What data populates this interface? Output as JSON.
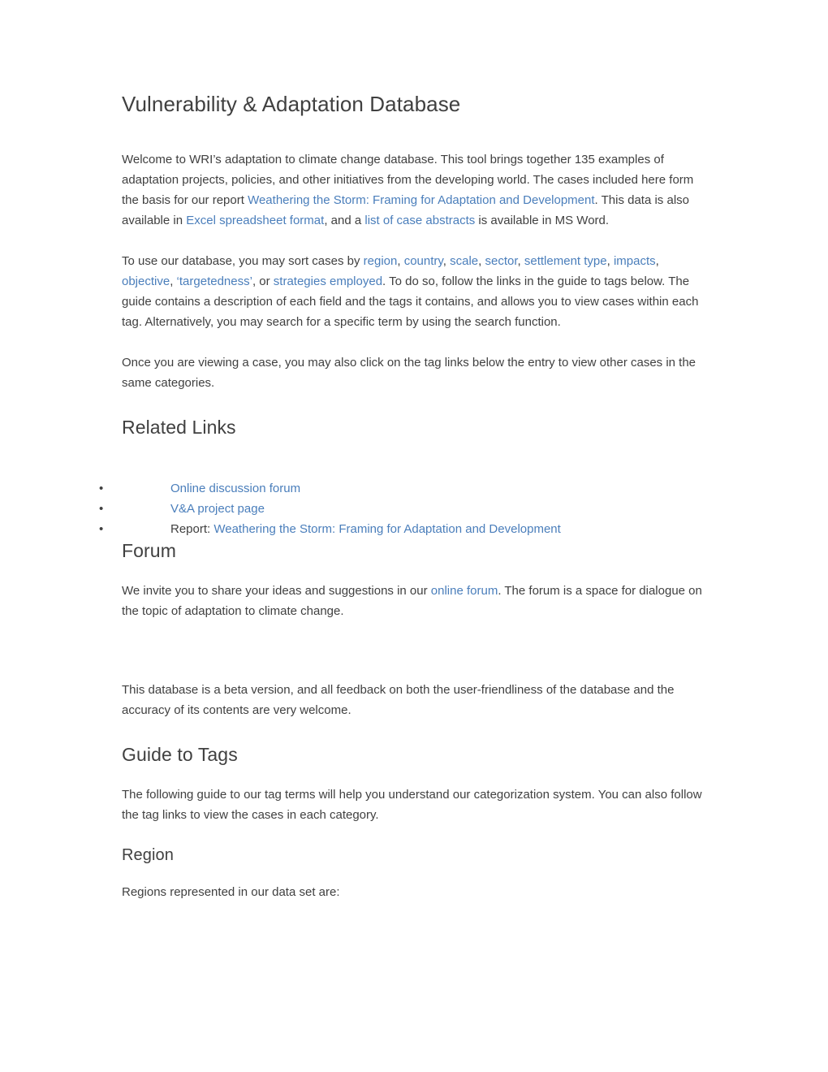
{
  "document": {
    "title": "Vulnerability & Adaptation Database",
    "intro": {
      "p1_part1": "Welcome to WRI’s adaptation to climate change database. This tool brings together 135 examples of adaptation projects, policies, and other initiatives from the developing world. The cases included here form the basis for our report ",
      "p1_link1": "Weathering the Storm: Framing for Adaptation and Development",
      "p1_part2": ". This data is also available in ",
      "p1_link2": "Excel spreadsheet format",
      "p1_part3": ", and a ",
      "p1_link3": "list of case abstracts",
      "p1_part4": " is available in MS Word."
    },
    "sorting": {
      "lead": "To use our database, you may sort cases by ",
      "link_region": "region",
      "sep1": ", ",
      "link_country": "country",
      "sep2": ", ",
      "link_scale": "scale",
      "sep3": ", ",
      "link_sector": "sector",
      "sep4": ", ",
      "link_settlement_type": "settlement type",
      "sep5": ", ",
      "link_impacts": "impacts",
      "sep6": ", ",
      "link_objective": "objective",
      "sep7": ", ",
      "link_targetedness": "‘targetedness’",
      "sep8": ", or ",
      "link_strategies": "strategies employed",
      "tail": ". To do so, follow the links in the guide to tags below. The guide contains a description of each field and the tags it contains, and allows you to view cases within each tag. Alternatively, you may search for a specific term by using the search function."
    },
    "viewing_paragraph": "Once you are viewing a case, you may also click on the tag links below the entry to view other cases in the same categories.",
    "related_links": {
      "heading": "Related Links",
      "items": [
        {
          "bullet": "•",
          "prefix": "",
          "link": "Online discussion forum"
        },
        {
          "bullet": "•",
          "prefix": "",
          "link": "V&A project page"
        },
        {
          "bullet": "•",
          "prefix": "Report: ",
          "link": "Weathering the Storm: Framing for Adaptation and Development"
        }
      ]
    },
    "forum": {
      "heading": "Forum",
      "p_part1": "We invite you to share your ideas and suggestions in our ",
      "p_link": "online forum",
      "p_part2": ". The forum is a space for dialogue on the topic of adaptation to climate change.",
      "beta_note": "This database is a beta version, and all feedback on both the user-friendliness of the database and the accuracy of its contents are very welcome."
    },
    "guide_to_tags": {
      "heading": "Guide to Tags",
      "description": "The following guide to our tag terms will help you understand our categorization system. You can also follow the tag links to view the cases in each category.",
      "region": {
        "heading": "Region",
        "text": "Regions represented in our data set are:"
      }
    },
    "colors": {
      "link": "#4a7ebb",
      "text": "#404040",
      "background": "#ffffff"
    }
  }
}
